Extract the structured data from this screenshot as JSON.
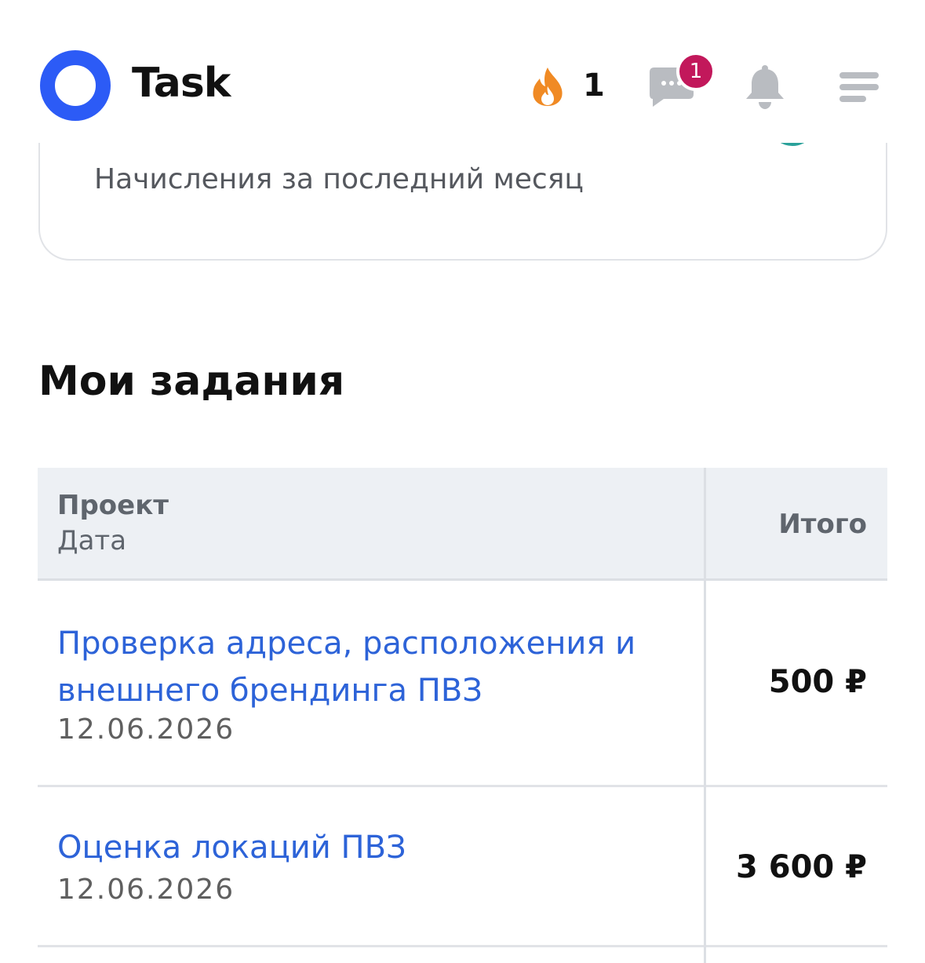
{
  "header": {
    "app_title": "Task",
    "streak_count": "1",
    "chat_badge": "1"
  },
  "earnings_card": {
    "label": "Начисления за последний месяц"
  },
  "tasks_section": {
    "title": "Мои задания",
    "table": {
      "col_project": "Проект",
      "col_date": "Дата",
      "col_total": "Итого",
      "rows": [
        {
          "title": "Проверка адреса, расположения и внешнего брендинга ПВЗ",
          "date": "12.06.2026",
          "amount": "500 ₽"
        },
        {
          "title": "Оценка локаций ПВЗ",
          "date": "12.06.2026",
          "amount": "3 600 ₽"
        }
      ]
    }
  },
  "colors": {
    "brand_blue": "#2c5bf6",
    "link_blue": "#2d63d8",
    "badge_magenta": "#c2185b",
    "fire_orange": "#f08a24",
    "icon_gray": "#b9bcc1"
  }
}
